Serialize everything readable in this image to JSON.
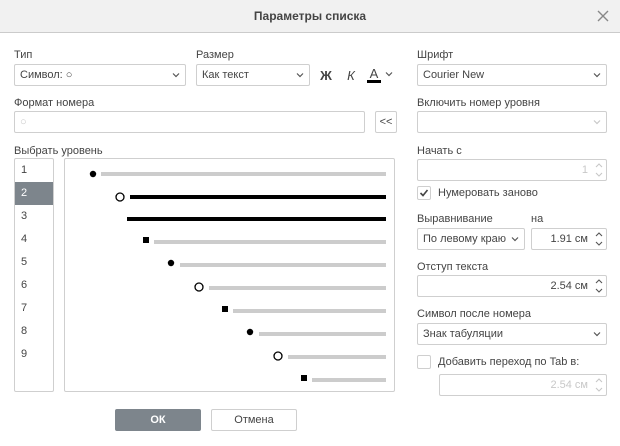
{
  "dialog": {
    "title": "Параметры списка"
  },
  "type": {
    "label": "Тип",
    "value": "Символ: ○"
  },
  "size": {
    "label": "Размер",
    "value": "Как текст"
  },
  "format_buttons": {
    "bold": "Ж",
    "italic": "К",
    "color": "A"
  },
  "font": {
    "label": "Шрифт",
    "value": "Courier New"
  },
  "number_format": {
    "label": "Формат номера",
    "value": "○",
    "insert_button": "<<"
  },
  "include_level": {
    "label": "Включить номер уровня",
    "value": ""
  },
  "choose_level": {
    "label": "Выбрать уровень",
    "items": [
      "1",
      "2",
      "3",
      "4",
      "5",
      "6",
      "7",
      "8",
      "9"
    ],
    "selected": "2"
  },
  "start_at": {
    "label": "Начать с",
    "value": "1"
  },
  "renumber": {
    "label": "Нумеровать заново",
    "checked": true
  },
  "alignment": {
    "label": "Выравнивание",
    "value": "По левому краю"
  },
  "at": {
    "label": "на",
    "value": "1.91 см"
  },
  "text_indent": {
    "label": "Отступ текста",
    "value": "2.54 см"
  },
  "after_number": {
    "label": "Символ после номера",
    "value": "Знак табуляции"
  },
  "add_tab": {
    "label": "Добавить переход по Tab в:",
    "checked": false,
    "value": "2.54 см"
  },
  "buttons": {
    "ok": "ОК",
    "cancel": "Отмена"
  },
  "colors": {
    "accent": "#7d858c",
    "border": "#cfcfcf",
    "preview_line": "#cccccc",
    "active_line": "#000000"
  },
  "preview_levels": [
    {
      "bullet": "filled-dot",
      "active": false
    },
    {
      "bullet": "hollow-circle",
      "active": true
    },
    {
      "bullet": "none",
      "active": true
    },
    {
      "bullet": "square",
      "active": false
    },
    {
      "bullet": "filled-dot",
      "active": false
    },
    {
      "bullet": "hollow-circle",
      "active": false
    },
    {
      "bullet": "square",
      "active": false
    },
    {
      "bullet": "filled-dot",
      "active": false
    },
    {
      "bullet": "hollow-circle",
      "active": false
    },
    {
      "bullet": "square",
      "active": false
    }
  ]
}
